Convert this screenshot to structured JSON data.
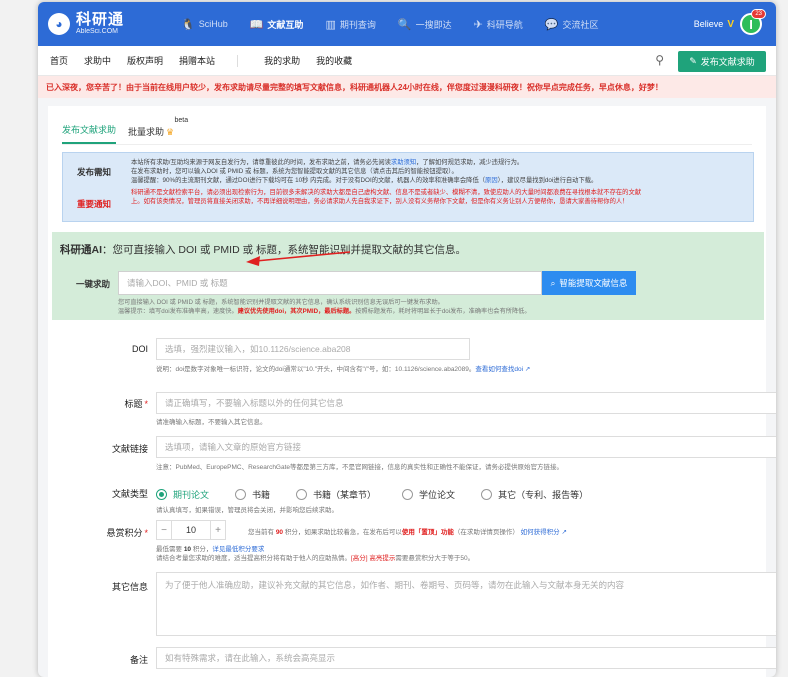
{
  "header": {
    "logo_main": "科研通",
    "logo_sub": "AbleSci.COM",
    "nav": [
      {
        "label": "SciHub",
        "icon": "🐧"
      },
      {
        "label": "文献互助",
        "icon": "📖"
      },
      {
        "label": "期刊查询",
        "icon": "▥"
      },
      {
        "label": "一搜即达",
        "icon": "🔍"
      },
      {
        "label": "科研导航",
        "icon": "✈"
      },
      {
        "label": "交流社区",
        "icon": "💬"
      }
    ],
    "user_name": "Believe",
    "vip_mark": "V",
    "avatar_letter": "I",
    "notification_count": "23"
  },
  "subnav": {
    "items": [
      "首页",
      "求助中",
      "版权声明",
      "捐赠本站"
    ],
    "right_items": [
      "我的求助",
      "我的收藏"
    ],
    "publish_button": "发布文献求助"
  },
  "notice": "已入深夜，您辛苦了！由于当前在线用户较少，发布求助请尽量完整的填写文献信息，科研通机器人24小时在线，伴您度过漫漫科研夜！祝你早点完成任务，早点休息，好梦！",
  "tabs": {
    "publish": "发布文献求助",
    "batch": "批量求助",
    "beta": "beta"
  },
  "info": {
    "label_publish": "发布需知",
    "label_important": "重要通知",
    "line1_a": "本站所有求助/互助均来源于网友自发行为，请尊重彼此的时间，发布求助之前，请务必先阅读",
    "line1_link": "求助须知",
    "line1_b": "，了解如何规范求助，减少违规行为。",
    "line2": "在发布求助时，您可以输入DOI 或 PMID 或 标题，系统为您智能提取文献的其它信息（请点击其后的智能按钮提取）。",
    "line3_a": "温馨提醒：90%的主流期刊文献，通过DOI进行下载均可在 10秒 内完成。对于没有DOI的文献，机器人的效率和准确率会降低（",
    "line3_link": "原因",
    "line3_b": "），建议尽量找到doi进行自动下载。",
    "line4": "科研通不是文献检索平台，请必须出现检索行为，目前很多未解决的求助大都是自己虚构文献、信息不是或者缺少、模糊不清，致使应助人的大量时间都浪费在寻找根本就不存在的文献",
    "line5": "上。如有该类情况，管理员将直接关闭求助，不再详细说明理由，务必请求助人先自我求证下，别人没有义务帮你下文献，但是你有义务让别人方便帮你，恳请大家善待帮你的人！"
  },
  "ai": {
    "title_prefix": "科研通AI",
    "title_rest": "：您可直接输入 DOI 或 PMID 或 标题，系统智能识别并提取文献的其它信息。",
    "label": "一键求助",
    "placeholder": "请输入DOI、PMID 或 标题",
    "button": "智能提取文献信息",
    "help1": "您可直接输入 DOI 或 PMID 或 标题，系统智能识别并提取文献的其它信息，确认系统识别信息无误后可一键发布求助。",
    "help2_a": "温馨提示：填写doi发布准确率高，速度快。",
    "help2_b": "建议优先使用doi，其次PMID，最后标题。",
    "help2_c": "按照标题发布，耗时将明显长于doi发布，准确率也会有所降低。"
  },
  "form": {
    "doi_label": "DOI",
    "doi_placeholder": "选填，强烈建议输入，如10.1126/science.aba208",
    "doi_hint_a": "说明：doi是数字对象唯一标识符，论文的doi通常以\"10.\"开头，中间含有\"/\"号，如：10.1126/science.aba2089。",
    "doi_hint_link": "查看如何查找doi",
    "title_label": "标题",
    "title_placeholder": "请正确填写，不要输入标题以外的任何其它信息",
    "title_hint": "请准确输入标题，不要输入其它信息。",
    "link_label": "文献链接",
    "link_placeholder": "选填项，请输入文章的原始官方链接",
    "link_hint": "注意：PubMed、EuropePMC、ResearchGate等都是第三方库，不是官网链接，信息的真实性和正确性不能保证，请务必提供原始官方链接。",
    "type_label": "文献类型",
    "types": [
      "期刊论文",
      "书籍",
      "书籍（某章节）",
      "学位论文",
      "其它（专利、报告等）"
    ],
    "type_hint": "请认真填写，如果错误，管理员将会关闭，并影响您后续求助。",
    "points_label": "悬赏积分",
    "points_value": "10",
    "points_minus": "−",
    "points_plus": "+",
    "points_note_a": "您当前有",
    "points_note_num": "90",
    "points_note_b": "积分，如果求助比较着急，在发布后可以",
    "points_note_c": "使用「置顶」功能",
    "points_note_d": "（在求助详情页操作）",
    "points_note_link": "如何获得积分",
    "points_hint1_a": "最低需要",
    "points_hint1_num": "10",
    "points_hint1_b": "积分，",
    "points_hint1_link": "详见最低积分要求",
    "points_hint2_a": "请结合考量您求助的难度，适当提高积分将有助于他人的应助热情。",
    "points_hint2_b": "[高分] 高亮提示",
    "points_hint2_c": "需要悬赏积分大于等于50。",
    "other_label": "其它信息",
    "other_placeholder": "为了便于他人准确应助，建议补充文献的其它信息，如作者、期刊、卷期号、页码等，请勿在此输入与文献本身无关的内容",
    "remark_label": "备注",
    "remark_placeholder": "如有特殊需求，请在此输入，系统会高亮显示"
  },
  "colors": {
    "brand_blue": "#2d6bd6",
    "brand_green": "#1fa37b",
    "notice_red": "#d9302a"
  }
}
